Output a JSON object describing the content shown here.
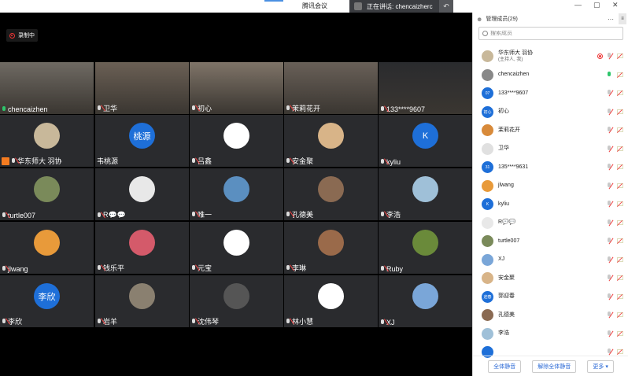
{
  "window": {
    "title": "腾讯会议",
    "controls": [
      "—",
      "▢",
      "✕"
    ]
  },
  "speaking": {
    "text": "正在讲话: chencaizherc",
    "back_icon": "↶"
  },
  "recording": {
    "label": "录制中"
  },
  "tiles": [
    {
      "name": "chencaizhen",
      "type": "video",
      "bg": "#6f6a63",
      "mic": "on"
    },
    {
      "name": "卫华",
      "type": "video",
      "bg": "#6b6055",
      "mic": "off"
    },
    {
      "name": "初心",
      "type": "video",
      "bg": "#7f7468",
      "mic": "off"
    },
    {
      "name": "茉莉花开",
      "type": "video",
      "bg": "#696058",
      "mic": "off"
    },
    {
      "name": "133****9607",
      "type": "video",
      "bg": "#2a2b2e",
      "mic": "off"
    },
    {
      "name": "华东师大 羽协",
      "type": "avatar",
      "bg": "#c8b89a",
      "mic": "off",
      "host": true
    },
    {
      "name": "韦桃源",
      "type": "avatar",
      "bg": "#1e6fd8",
      "avatar_text": "桃源",
      "mic": "none"
    },
    {
      "name": "吕鑫",
      "type": "avatar",
      "bg": "#ffffff",
      "mic": "off"
    },
    {
      "name": "安金聚",
      "type": "avatar",
      "bg": "#d8b488",
      "mic": "off"
    },
    {
      "name": "kyliu",
      "type": "avatar",
      "bg": "#1e6fd8",
      "avatar_text": "K",
      "mic": "off"
    },
    {
      "name": "turtle007",
      "type": "avatar",
      "bg": "#7a8a5a",
      "mic": "off"
    },
    {
      "name": "R💬💬",
      "type": "avatar",
      "bg": "#e8e8e8",
      "mic": "off"
    },
    {
      "name": "唯一",
      "type": "avatar",
      "bg": "#5b8fc0",
      "mic": "off"
    },
    {
      "name": "孔德美",
      "type": "avatar",
      "bg": "#8a6a52",
      "mic": "off"
    },
    {
      "name": "李浩",
      "type": "avatar",
      "bg": "#9fc0d8",
      "mic": "off"
    },
    {
      "name": "jlwang",
      "type": "avatar",
      "bg": "#e89a3a",
      "mic": "off"
    },
    {
      "name": "钱乐平",
      "type": "avatar",
      "bg": "#d45a6a",
      "mic": "off"
    },
    {
      "name": "元宝",
      "type": "avatar",
      "bg": "#ffffff",
      "mic": "off"
    },
    {
      "name": "李琳",
      "type": "avatar",
      "bg": "#9a6a4a",
      "mic": "off"
    },
    {
      "name": "Ruby",
      "type": "avatar",
      "bg": "#6a8a3a",
      "mic": "off"
    },
    {
      "name": "李欣",
      "type": "avatar",
      "bg": "#1e6fd8",
      "avatar_text": "李欣",
      "mic": "off"
    },
    {
      "name": "岩羊",
      "type": "avatar",
      "bg": "#8a8070",
      "mic": "off"
    },
    {
      "name": "沈伟琴",
      "type": "avatar",
      "bg": "#555555",
      "mic": "off"
    },
    {
      "name": "林小慧",
      "type": "avatar",
      "bg": "#ffffff",
      "mic": "off"
    },
    {
      "name": "XJ",
      "type": "avatar",
      "bg": "#7aa6d8",
      "mic": "off"
    }
  ],
  "panel": {
    "title": "管理成员(29)",
    "more": "···",
    "search_placeholder": "搜索成员",
    "members": [
      {
        "name": "华东师大 羽协",
        "role": "(主持人, 我)",
        "bg": "#c8b89a",
        "av": "",
        "mic": "off",
        "rec": true
      },
      {
        "name": "chencaizhen",
        "role": "",
        "bg": "#888",
        "av": "",
        "mic": "on"
      },
      {
        "name": "133****9607",
        "role": "",
        "bg": "#1e6fd8",
        "av": "07",
        "mic": "off"
      },
      {
        "name": "初心",
        "role": "",
        "bg": "#1e6fd8",
        "av": "初心",
        "mic": "off"
      },
      {
        "name": "茉莉花开",
        "role": "",
        "bg": "#d88a3a",
        "av": "",
        "mic": "off"
      },
      {
        "name": "卫华",
        "role": "",
        "bg": "#e0e0e0",
        "av": "",
        "mic": "off"
      },
      {
        "name": "135****9631",
        "role": "",
        "bg": "#1e6fd8",
        "av": "31",
        "mic": "off"
      },
      {
        "name": "jlwang",
        "role": "",
        "bg": "#e89a3a",
        "av": "",
        "mic": "off"
      },
      {
        "name": "kyliu",
        "role": "",
        "bg": "#1e6fd8",
        "av": "K",
        "mic": "off"
      },
      {
        "name": "R💬💬",
        "role": "",
        "bg": "#e8e8e8",
        "av": "",
        "mic": "off"
      },
      {
        "name": "turtle007",
        "role": "",
        "bg": "#7a8a5a",
        "av": "",
        "mic": "off"
      },
      {
        "name": "XJ",
        "role": "",
        "bg": "#7aa6d8",
        "av": "",
        "mic": "off"
      },
      {
        "name": "安金聚",
        "role": "",
        "bg": "#d8b488",
        "av": "",
        "mic": "off"
      },
      {
        "name": "郭迎春",
        "role": "",
        "bg": "#1e6fd8",
        "av": "迎春",
        "mic": "off"
      },
      {
        "name": "孔德美",
        "role": "",
        "bg": "#8a6a52",
        "av": "",
        "mic": "off"
      },
      {
        "name": "李浩",
        "role": "",
        "bg": "#9fc0d8",
        "av": "",
        "mic": "off"
      },
      {
        "name": "",
        "role": "",
        "bg": "#1e6fd8",
        "av": "",
        "mic": "off"
      }
    ],
    "footer": {
      "mute_all": "全体静音",
      "unmute_all": "解除全体静音",
      "more": "更多 ▾"
    }
  }
}
